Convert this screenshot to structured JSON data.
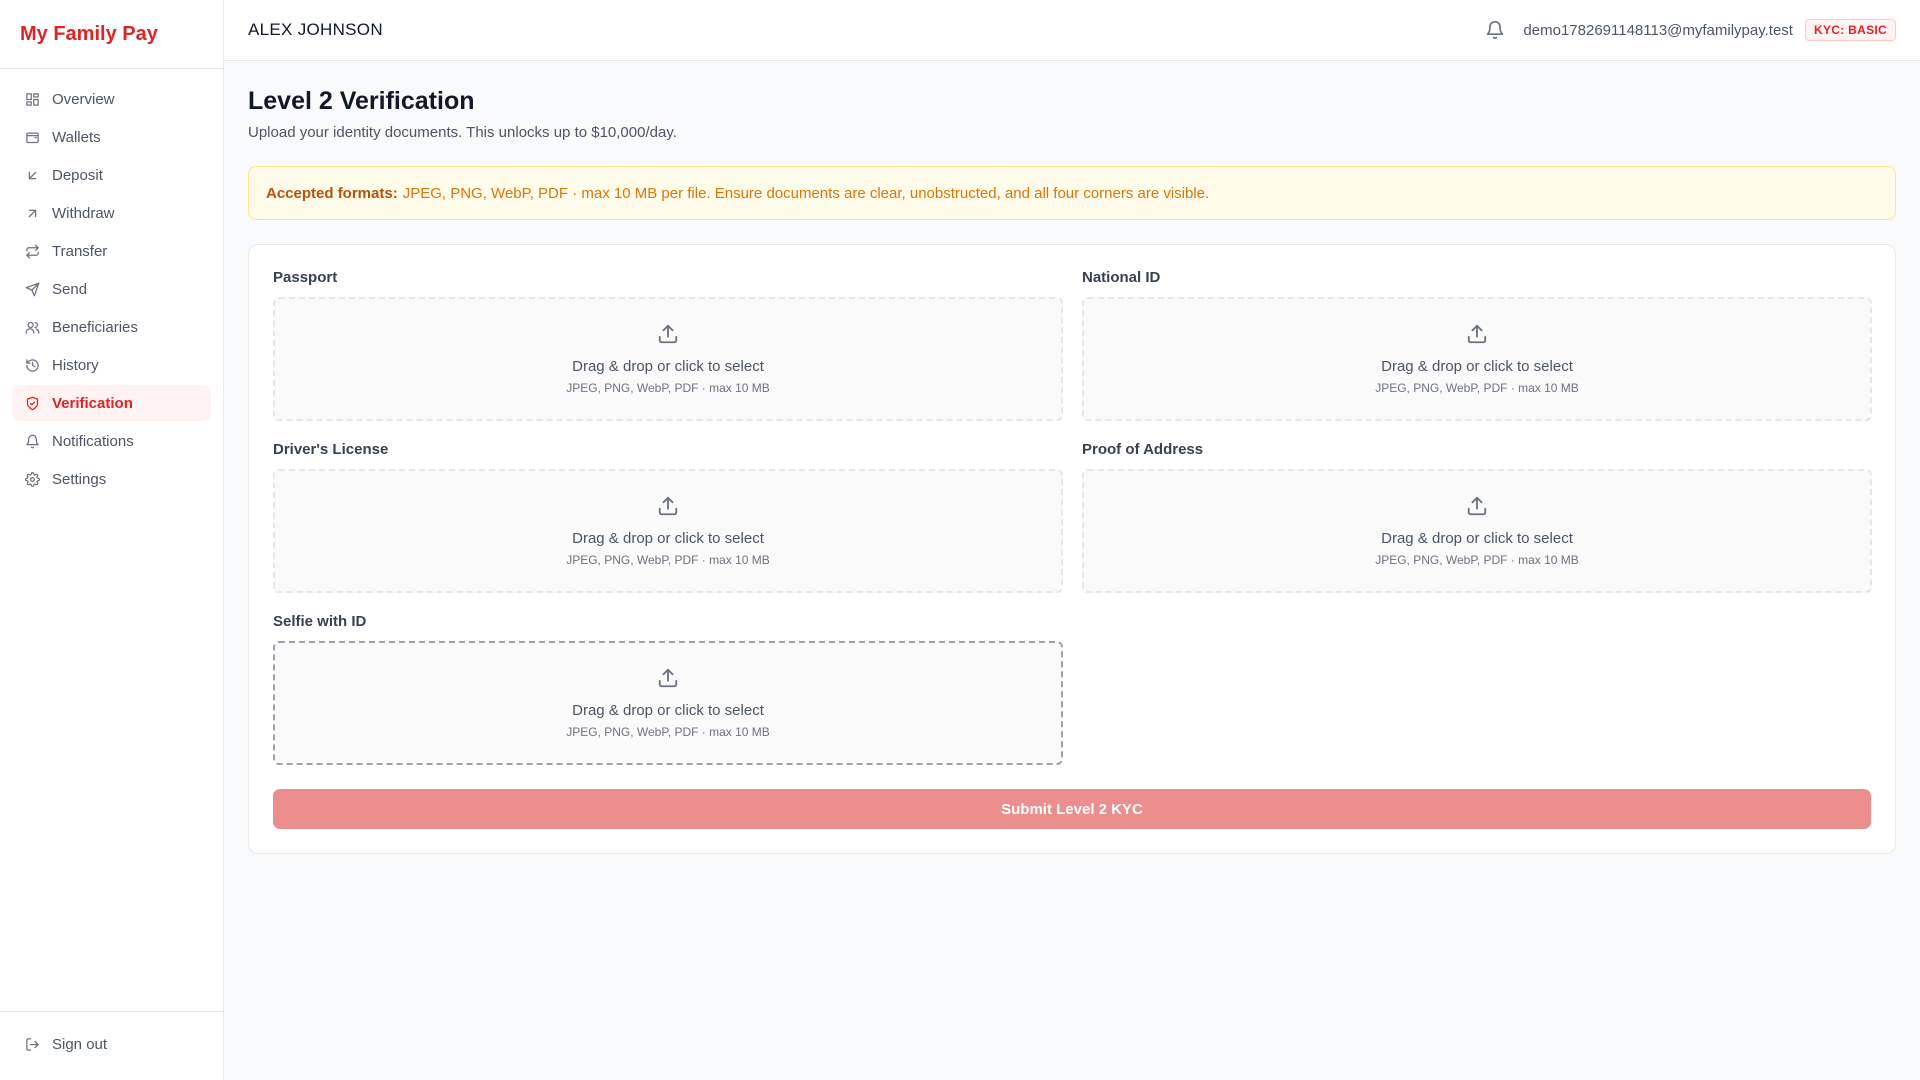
{
  "app": {
    "brand": "My Family Pay"
  },
  "sidebar": {
    "items": [
      {
        "label": "Overview",
        "icon": "grid-icon"
      },
      {
        "label": "Wallets",
        "icon": "wallet-icon"
      },
      {
        "label": "Deposit",
        "icon": "arrow-down-left-icon"
      },
      {
        "label": "Withdraw",
        "icon": "arrow-up-right-icon"
      },
      {
        "label": "Transfer",
        "icon": "repeat-icon"
      },
      {
        "label": "Send",
        "icon": "send-icon"
      },
      {
        "label": "Beneficiaries",
        "icon": "users-icon"
      },
      {
        "label": "History",
        "icon": "history-icon"
      },
      {
        "label": "Verification",
        "icon": "shield-check-icon",
        "active": true
      },
      {
        "label": "Notifications",
        "icon": "bell-icon"
      },
      {
        "label": "Settings",
        "icon": "gear-icon"
      }
    ],
    "signout": {
      "label": "Sign out",
      "icon": "log-out-icon"
    }
  },
  "header": {
    "user_name": "ALEX JOHNSON",
    "email": "demo1782691148113@myfamilypay.test",
    "kyc_badge": "KYC: BASIC"
  },
  "main": {
    "title": "Level 2 Verification",
    "subtitle": "Upload your identity documents. This unlocks up to $10,000/day.",
    "notice": {
      "label": "Accepted formats:",
      "text": "JPEG, PNG, WebP, PDF · max 10 MB per file. Ensure documents are clear, unobstructed, and all four corners are visible."
    },
    "uploads": [
      {
        "label": "Passport",
        "prompt": "Drag & drop or click to select",
        "hint": "JPEG, PNG, WebP, PDF · max 10 MB"
      },
      {
        "label": "National ID",
        "prompt": "Drag & drop or click to select",
        "hint": "JPEG, PNG, WebP, PDF · max 10 MB"
      },
      {
        "label": "Driver's License",
        "prompt": "Drag & drop or click to select",
        "hint": "JPEG, PNG, WebP, PDF · max 10 MB"
      },
      {
        "label": "Proof of Address",
        "prompt": "Drag & drop or click to select",
        "hint": "JPEG, PNG, WebP, PDF · max 10 MB"
      },
      {
        "label": "Selfie with ID",
        "prompt": "Drag & drop or click to select",
        "hint": "JPEG, PNG, WebP, PDF · max 10 MB"
      }
    ],
    "submit_label": "Submit Level 2 KYC"
  },
  "colors": {
    "accent": "#dc2626",
    "submit_disabled": "#ec8e8e",
    "notice_bg": "#fffbeb",
    "notice_text": "#d97706"
  }
}
